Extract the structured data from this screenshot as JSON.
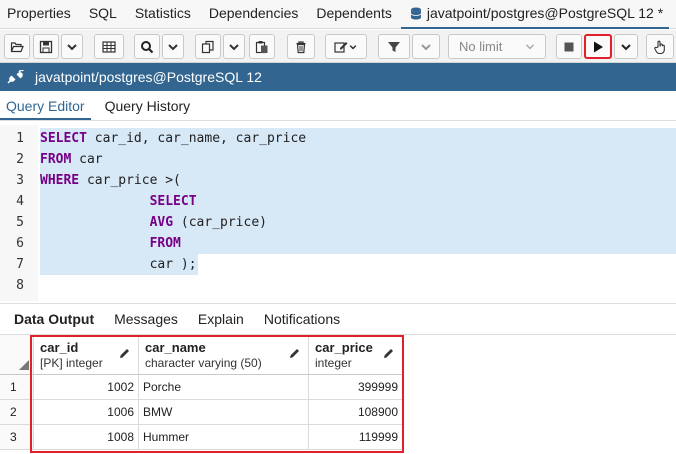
{
  "tabs": [
    "Properties",
    "SQL",
    "Statistics",
    "Dependencies",
    "Dependents"
  ],
  "active_tab": "javatpoint/postgres@PostgreSQL 12 *",
  "toolbar": {
    "limit_label": "No limit"
  },
  "connection": "javatpoint/postgres@PostgreSQL 12",
  "editor_tabs": {
    "query_editor": "Query Editor",
    "query_history": "Query History"
  },
  "code_lines": [
    {
      "num": "1",
      "parts": [
        {
          "t": "SELECT",
          "kw": true
        },
        {
          "t": " car_id, car_name, car_price",
          "kw": false
        }
      ]
    },
    {
      "num": "2",
      "parts": [
        {
          "t": "FROM",
          "kw": true
        },
        {
          "t": " car",
          "kw": false
        }
      ]
    },
    {
      "num": "3",
      "parts": [
        {
          "t": "WHERE",
          "kw": true
        },
        {
          "t": " car_price >(",
          "kw": false
        }
      ]
    },
    {
      "num": "4",
      "parts": [
        {
          "t": "              ",
          "kw": false
        },
        {
          "t": "SELECT",
          "kw": true
        }
      ]
    },
    {
      "num": "5",
      "parts": [
        {
          "t": "              ",
          "kw": false
        },
        {
          "t": "AVG",
          "kw": true
        },
        {
          "t": " (car_price)",
          "kw": false
        }
      ]
    },
    {
      "num": "6",
      "parts": [
        {
          "t": "              ",
          "kw": false
        },
        {
          "t": "FROM",
          "kw": true
        }
      ]
    },
    {
      "num": "7",
      "parts": [
        {
          "t": "              car );",
          "kw": false
        }
      ]
    },
    {
      "num": "8",
      "parts": []
    }
  ],
  "result_tabs": {
    "data_output": "Data Output",
    "messages": "Messages",
    "explain": "Explain",
    "notifications": "Notifications"
  },
  "columns": [
    {
      "name": "car_id",
      "type": "[PK] integer"
    },
    {
      "name": "car_name",
      "type": "character varying (50)"
    },
    {
      "name": "car_price",
      "type": "integer"
    }
  ],
  "rows": [
    {
      "num": "1",
      "car_id": "1002",
      "car_name": "Porche",
      "car_price": "399999"
    },
    {
      "num": "2",
      "car_id": "1006",
      "car_name": "BMW",
      "car_price": "108900"
    },
    {
      "num": "3",
      "car_id": "1008",
      "car_name": "Hummer",
      "car_price": "119999"
    }
  ],
  "colors": {
    "accent": "#326690",
    "highlight": "#e0202a",
    "selection": "#d7e8f7",
    "keyword": "#770088"
  }
}
